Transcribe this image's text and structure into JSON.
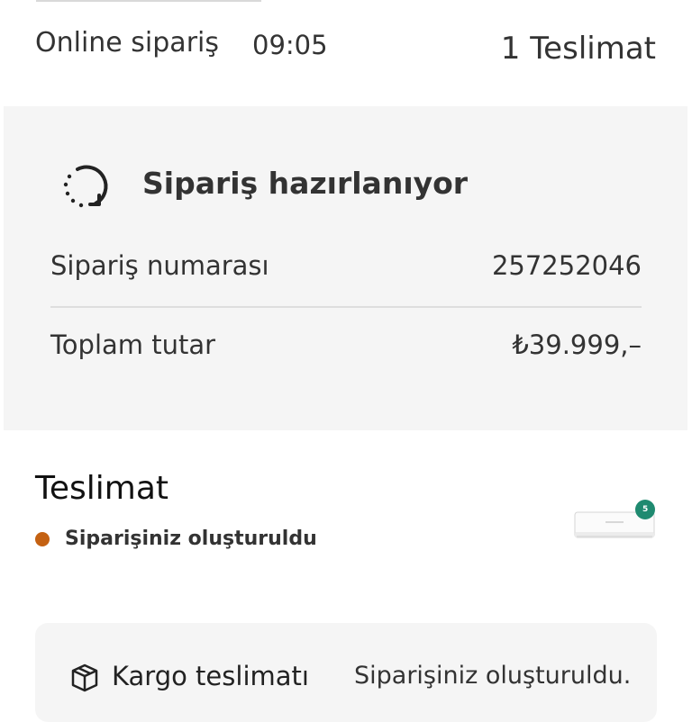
{
  "header": {
    "order_type": "Online sipariş",
    "order_time": "09:05",
    "delivery_count": "1 Teslimat"
  },
  "status_card": {
    "icon": "refresh-icon",
    "title": "Sipariş hazırlanıyor",
    "rows": [
      {
        "label": "Sipariş numarası",
        "value": "257252046"
      },
      {
        "label": "Toplam tutar",
        "value": "₺39.999,–"
      }
    ]
  },
  "delivery": {
    "heading": "Teslimat",
    "status": "Siparişiniz oluşturuldu",
    "status_color": "#c46112",
    "product_badge": "5",
    "product_badge_color": "#1f8a70"
  },
  "shipping": {
    "icon": "package-icon",
    "label": "Kargo teslimatı",
    "status": "Siparişiniz oluşturuldu."
  }
}
